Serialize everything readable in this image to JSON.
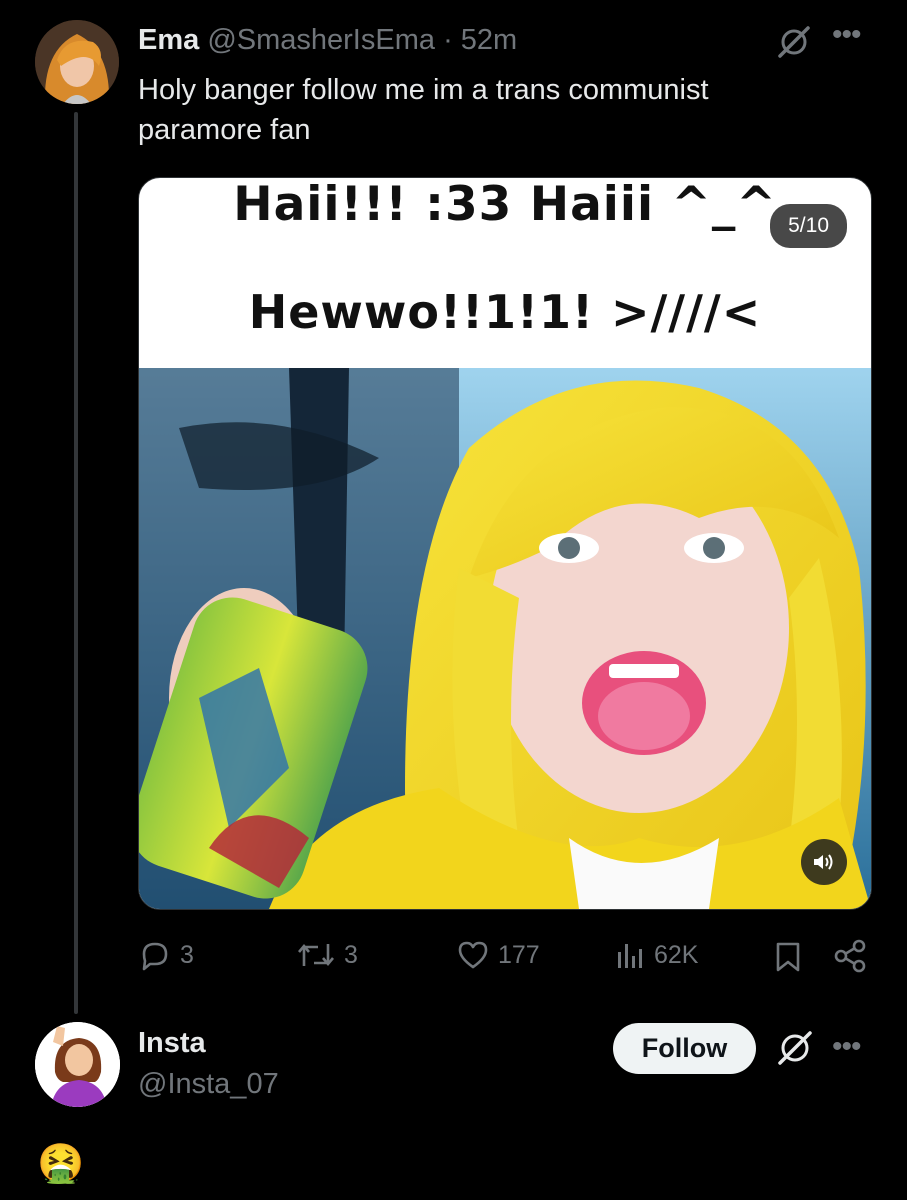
{
  "tweet": {
    "author_name": "Ema",
    "handle": "@SmasherIsEma",
    "separator": "·",
    "time": "52m",
    "text": "Holy banger follow me im a trans communist paramore fan",
    "media": {
      "caption_line1": "Haii!!! :33 Haiii ^_^",
      "caption_line2": "Hewwo!!1!1! >////<",
      "counter": "5/10"
    },
    "actions": {
      "replies": "3",
      "reposts": "3",
      "likes": "177",
      "views": "62K"
    },
    "icons": [
      "grok-icon",
      "more-icon",
      "reply-icon",
      "repost-icon",
      "like-icon",
      "views-icon",
      "bookmark-icon",
      "share-icon",
      "volume-icon"
    ]
  },
  "reply": {
    "author_name": "Insta",
    "handle": "@Insta_07",
    "follow_label": "Follow",
    "emoji": "🤮"
  },
  "colors": {
    "background": "#000000",
    "text": "#e7e9ea",
    "muted": "#71767b",
    "follow_bg": "#eff3f4"
  }
}
